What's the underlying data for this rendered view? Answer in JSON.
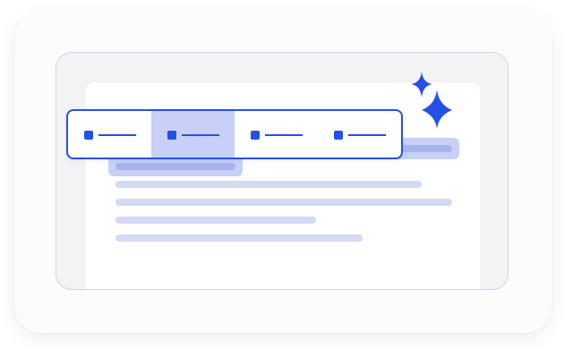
{
  "toolbar": {
    "items": [
      {
        "icon": "format-icon",
        "selected": false
      },
      {
        "icon": "format-icon",
        "selected": true
      },
      {
        "icon": "format-icon",
        "selected": false
      },
      {
        "icon": "format-icon",
        "selected": false
      }
    ]
  },
  "colors": {
    "accent": "#2450e8",
    "selection": "#c8d0f8",
    "highlight_line": "#a7b4ec",
    "text_line": "#d3daf1",
    "frame_border": "#cdd5f4",
    "frame_background": "#f3f3f3"
  },
  "decoration": {
    "icon": "sparkle-icon"
  }
}
